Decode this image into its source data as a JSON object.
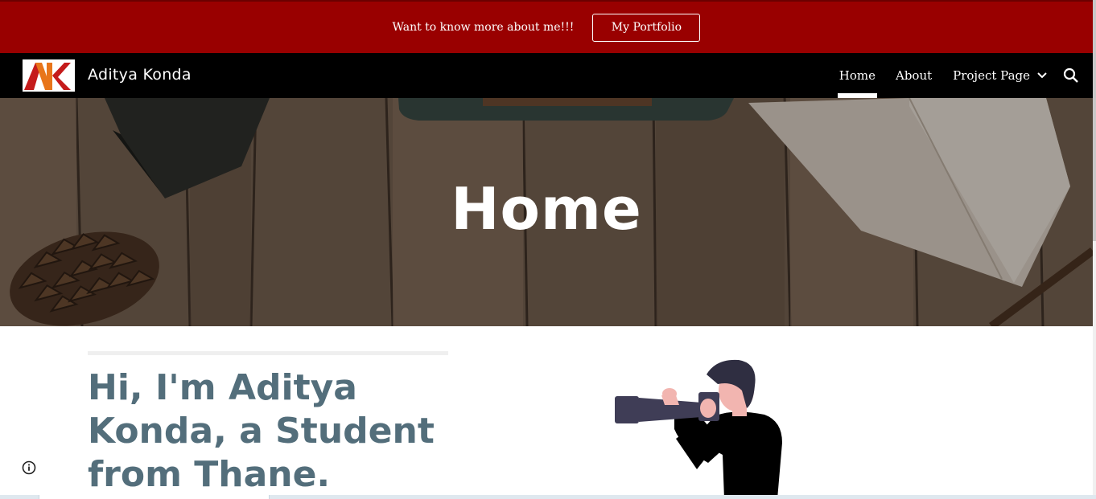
{
  "banner": {
    "text": "Want to know more about me!!!",
    "button_label": "My Portfolio",
    "color": "#990000"
  },
  "header": {
    "logo_text": "AK",
    "site_title": "Aditya Konda",
    "nav": {
      "home": "Home",
      "about": "About",
      "project": "Project Page"
    },
    "search_icon": "search-icon"
  },
  "hero": {
    "title": "Home"
  },
  "main": {
    "intro": "Hi, I'm Aditya Konda, a Student from Thane.",
    "heading_color": "#536e7b"
  },
  "icons": {
    "info": "info-icon",
    "chevron": "chevron-down-icon"
  }
}
